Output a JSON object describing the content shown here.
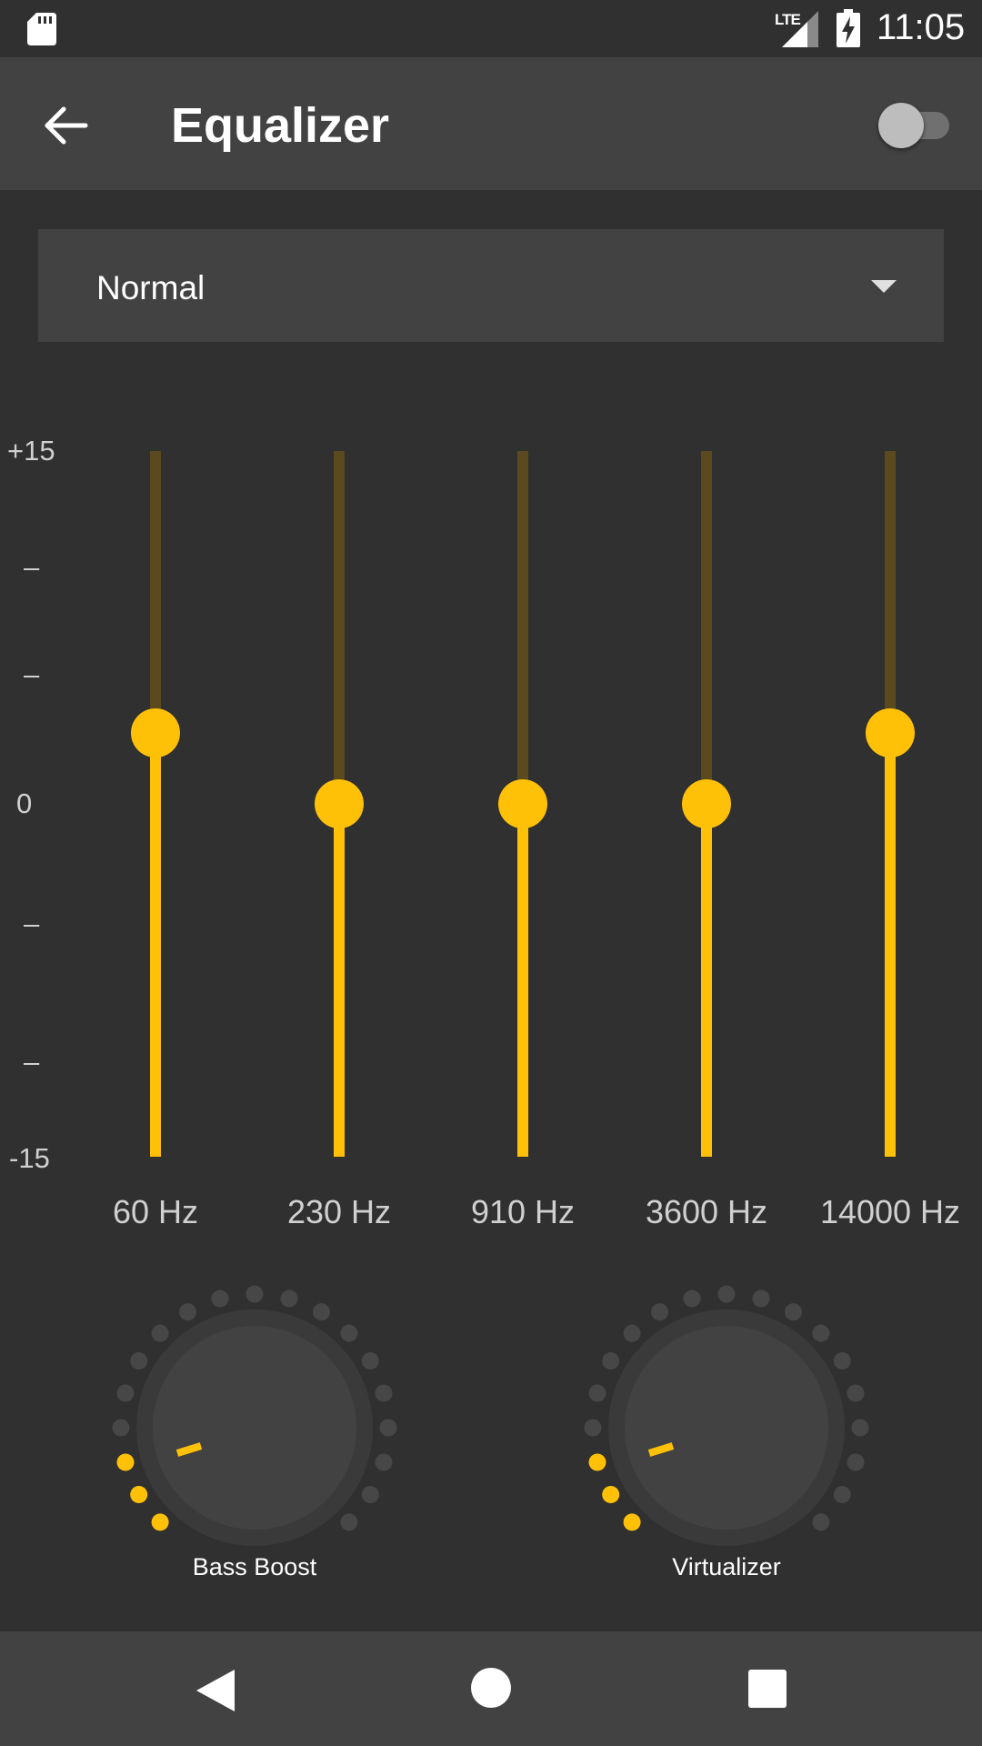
{
  "status_bar": {
    "network_label": "LTE",
    "time": "11:05",
    "icons": [
      "sd-card-icon",
      "signal-icon",
      "battery-charging-icon"
    ]
  },
  "app_bar": {
    "title": "Equalizer",
    "back_icon": "arrow-back-icon",
    "enabled": false
  },
  "preset": {
    "selected": "Normal"
  },
  "scale": {
    "top": "+15",
    "mid": "0",
    "bottom": "-15",
    "tick": "–"
  },
  "bands": [
    {
      "label": "60 Hz",
      "gain_db": 3
    },
    {
      "label": "230 Hz",
      "gain_db": 0
    },
    {
      "label": "910 Hz",
      "gain_db": 0
    },
    {
      "label": "3600 Hz",
      "gain_db": 0
    },
    {
      "label": "14000 Hz",
      "gain_db": 3
    }
  ],
  "knobs": [
    {
      "label": "Bass Boost",
      "active_dots": 3,
      "total_dots": 19
    },
    {
      "label": "Virtualizer",
      "active_dots": 3,
      "total_dots": 19
    }
  ],
  "colors": {
    "accent": "#ffc107",
    "accent_dim": "#5a4a1e",
    "background": "#303030",
    "surface": "#424242"
  }
}
